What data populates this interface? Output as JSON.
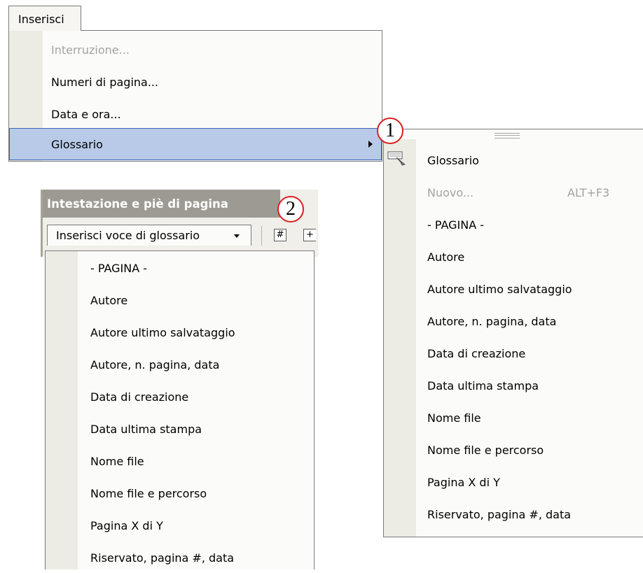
{
  "menu": {
    "title": "Inserisci",
    "items": [
      {
        "label": "Interruzione...",
        "disabled": true
      },
      {
        "label": "Numeri di pagina...",
        "disabled": false
      },
      {
        "label": "Data e ora...",
        "disabled": false
      },
      {
        "label": "Glossario",
        "disabled": false,
        "highlighted": true,
        "has_submenu": true
      }
    ]
  },
  "callouts": {
    "one": "1",
    "two": "2"
  },
  "submenu": {
    "items": [
      {
        "label": "Glossario",
        "icon": "glossary-icon"
      },
      {
        "label": "Nuovo...",
        "shortcut": "ALT+F3",
        "disabled": true
      },
      {
        "label": "- PAGINA -"
      },
      {
        "label": "Autore"
      },
      {
        "label": "Autore ultimo salvataggio"
      },
      {
        "label": "Autore, n. pagina, data"
      },
      {
        "label": "Data di creazione"
      },
      {
        "label": "Data ultima stampa"
      },
      {
        "label": "Nome file"
      },
      {
        "label": "Nome file e percorso"
      },
      {
        "label": "Pagina X di Y"
      },
      {
        "label": "Riservato, pagina #, data"
      }
    ]
  },
  "toolbar": {
    "title": "Intestazione e piè di pagina",
    "button_label": "Inserisci voce di glossario",
    "icons": [
      "insert-page-number-icon",
      "insert-number-of-pages-icon"
    ]
  },
  "dropdown": {
    "items": [
      {
        "label": "- PAGINA -"
      },
      {
        "label": "Autore"
      },
      {
        "label": "Autore ultimo salvataggio"
      },
      {
        "label": "Autore, n. pagina, data"
      },
      {
        "label": "Data di creazione"
      },
      {
        "label": "Data ultima stampa"
      },
      {
        "label": "Nome file"
      },
      {
        "label": "Nome file e percorso"
      },
      {
        "label": "Pagina X di Y"
      },
      {
        "label": "Riservato, pagina #, data"
      }
    ]
  },
  "colors": {
    "highlight": "#b8cae8",
    "highlight_border": "#3e66b7",
    "callout_ring": "#d81f1f",
    "toolbar_title_bg": "#9c9a93"
  }
}
